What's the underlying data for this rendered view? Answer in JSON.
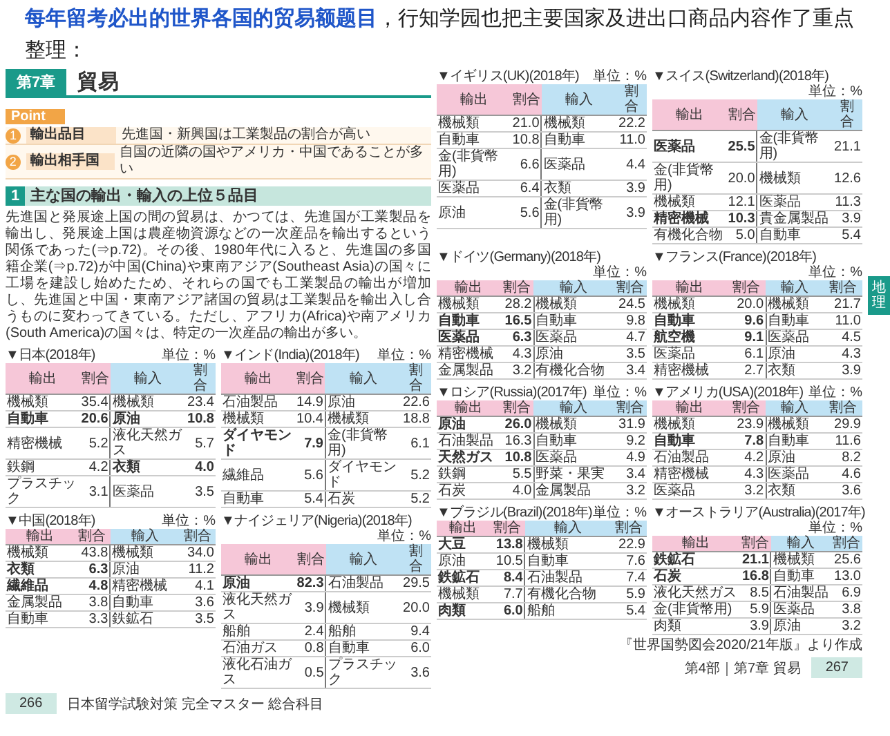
{
  "intro": "**每年留考必出的世界各国的贸易额题目**，行知学园也把主要国家及进出口商品内容作了重点整理：",
  "left_page": {
    "chapter": {
      "label": "第7章",
      "title": "貿易"
    },
    "point": {
      "label": "Point",
      "items": [
        {
          "number": "1",
          "label": "輸出品目",
          "text": "先進国・新興国は工業製品の割合が高い"
        },
        {
          "number": "2",
          "label": "輸出相手国",
          "text": "自国の近隣の国やアメリカ・中国であることが多い"
        }
      ]
    },
    "section": {
      "number": "1",
      "title": "主な国の輸出・輸入の上位５品目"
    },
    "paragraph": "先進国と発展途上国の間の貿易は、かつては、先進国が工業製品を輸出し、発展途上国は農産物資源などの一次産品を輸出するという関係であった(⇒p.72)。その後、1980年代に入ると、先進国の多国籍企業(⇒p.72)が中国(China)や東南アジア(Southeast Asia)の国々に工場を建設し始めたため、それらの国でも工業製品の輸出が増加し、先進国と中国・東南アジア諸国の貿易は工業製品を輸出入し合うものに変わってきている。ただし、アフリカ(Africa)や南アメリカ(South America)の国々は、特定の一次産品の輸出が多い。",
    "tables": [
      {
        "title": "▼日本(2018年)",
        "unit": "単位：%",
        "header": [
          "輸出",
          "割合",
          "輸入",
          "割合"
        ],
        "rows": [
          {
            "export": "機械類",
            "export_share": "35.4",
            "export_bold": false,
            "import": "機械類",
            "import_share": "23.4",
            "import_bold": false
          },
          {
            "export": "自動車",
            "export_share": "20.6",
            "export_bold": true,
            "import": "原油",
            "import_share": "10.8",
            "import_bold": true
          },
          {
            "export": "精密機械",
            "export_share": "5.2",
            "export_bold": false,
            "import": "液化天然ガス",
            "import_share": "5.7",
            "import_bold": false
          },
          {
            "export": "鉄鋼",
            "export_share": "4.2",
            "export_bold": false,
            "import": "衣類",
            "import_share": "4.0",
            "import_bold": true
          },
          {
            "export": "プラスチック",
            "export_share": "3.1",
            "export_bold": false,
            "import": "医薬品",
            "import_share": "3.5",
            "import_bold": false
          }
        ]
      },
      {
        "title": "▼インド(India)(2018年)",
        "unit": "単位：%",
        "header": [
          "輸出",
          "割合",
          "輸入",
          "割合"
        ],
        "rows": [
          {
            "export": "石油製品",
            "export_share": "14.9",
            "export_bold": false,
            "import": "原油",
            "import_share": "22.6",
            "import_bold": false
          },
          {
            "export": "機械類",
            "export_share": "10.4",
            "export_bold": false,
            "import": "機械類",
            "import_share": "18.8",
            "import_bold": false
          },
          {
            "export": "ダイヤモンド",
            "export_share": "7.9",
            "export_bold": true,
            "import": "金(非貨幣用)",
            "import_share": "6.1",
            "import_bold": false
          },
          {
            "export": "繊維品",
            "export_share": "5.6",
            "export_bold": false,
            "import": "ダイヤモンド",
            "import_share": "5.2",
            "import_bold": false
          },
          {
            "export": "自動車",
            "export_share": "5.4",
            "export_bold": false,
            "import": "石炭",
            "import_share": "5.2",
            "import_bold": false
          }
        ]
      },
      {
        "title": "▼中国(2018年)",
        "unit": "単位：%",
        "header": [
          "輸出",
          "割合",
          "輸入",
          "割合"
        ],
        "rows": [
          {
            "export": "機械類",
            "export_share": "43.8",
            "export_bold": false,
            "import": "機械類",
            "import_share": "34.0",
            "import_bold": false
          },
          {
            "export": "衣類",
            "export_share": "6.3",
            "export_bold": true,
            "import": "原油",
            "import_share": "11.2",
            "import_bold": false
          },
          {
            "export": "繊維品",
            "export_share": "4.8",
            "export_bold": true,
            "import": "精密機械",
            "import_share": "4.1",
            "import_bold": false
          },
          {
            "export": "金属製品",
            "export_share": "3.8",
            "export_bold": false,
            "import": "自動車",
            "import_share": "3.6",
            "import_bold": false
          },
          {
            "export": "自動車",
            "export_share": "3.3",
            "export_bold": false,
            "import": "鉄鉱石",
            "import_share": "3.5",
            "import_bold": false
          }
        ]
      },
      {
        "title": "▼ナイジェリア(Nigeria)(2018年)",
        "unit": "単位：%",
        "header": [
          "輸出",
          "割合",
          "輸入",
          "割合"
        ],
        "rows": [
          {
            "export": "原油",
            "export_share": "82.3",
            "export_bold": true,
            "import": "石油製品",
            "import_share": "29.5",
            "import_bold": false
          },
          {
            "export": "液化天然ガス",
            "export_share": "3.9",
            "export_bold": false,
            "import": "機械類",
            "import_share": "20.0",
            "import_bold": false
          },
          {
            "export": "船舶",
            "export_share": "2.4",
            "export_bold": false,
            "import": "船舶",
            "import_share": "9.4",
            "import_bold": false
          },
          {
            "export": "石油ガス",
            "export_share": "0.8",
            "export_bold": false,
            "import": "自動車",
            "import_share": "6.0",
            "import_bold": false
          },
          {
            "export": "液化石油ガス",
            "export_share": "0.5",
            "export_bold": false,
            "import": "プラスチック",
            "import_share": "3.6",
            "import_bold": false
          }
        ]
      }
    ],
    "footer": {
      "page_number": "266",
      "text": "日本留学試験対策 完全マスター 総合科目"
    }
  },
  "right_page": {
    "tables": [
      {
        "title": "▼イギリス(UK)(2018年)",
        "unit": "単位：%",
        "header": [
          "輸出",
          "割合",
          "輸入",
          "割合"
        ],
        "rows": [
          {
            "export": "機械類",
            "export_share": "21.0",
            "export_bold": false,
            "import": "機械類",
            "import_share": "22.2",
            "import_bold": false
          },
          {
            "export": "自動車",
            "export_share": "10.8",
            "export_bold": false,
            "import": "自動車",
            "import_share": "11.0",
            "import_bold": false
          },
          {
            "export": "金(非貨幣用)",
            "export_share": "6.6",
            "export_bold": false,
            "import": "医薬品",
            "import_share": "4.4",
            "import_bold": false
          },
          {
            "export": "医薬品",
            "export_share": "6.4",
            "export_bold": false,
            "import": "衣類",
            "import_share": "3.9",
            "import_bold": false
          },
          {
            "export": "原油",
            "export_share": "5.6",
            "export_bold": false,
            "import": "金(非貨幣用)",
            "import_share": "3.9",
            "import_bold": false
          }
        ]
      },
      {
        "title": "▼スイス(Switzerland)(2018年)",
        "unit": "単位：%",
        "header": [
          "輸出",
          "割合",
          "輸入",
          "割合"
        ],
        "rows": [
          {
            "export": "医薬品",
            "export_share": "25.5",
            "export_bold": true,
            "import": "金(非貨幣用)",
            "import_share": "21.1",
            "import_bold": false
          },
          {
            "export": "金(非貨幣用)",
            "export_share": "20.0",
            "export_bold": false,
            "import": "機械類",
            "import_share": "12.6",
            "import_bold": false
          },
          {
            "export": "機械類",
            "export_share": "12.1",
            "export_bold": false,
            "import": "医薬品",
            "import_share": "11.3",
            "import_bold": false
          },
          {
            "export": "精密機械",
            "export_share": "10.3",
            "export_bold": true,
            "import": "貴金属製品",
            "import_share": "3.9",
            "import_bold": false
          },
          {
            "export": "有機化合物",
            "export_share": "5.0",
            "export_bold": false,
            "import": "自動車",
            "import_share": "5.4",
            "import_bold": false
          }
        ]
      },
      {
        "title": "▼ドイツ(Germany)(2018年)",
        "unit": "単位：%",
        "header": [
          "輸出",
          "割合",
          "輸入",
          "割合"
        ],
        "rows": [
          {
            "export": "機械類",
            "export_share": "28.2",
            "export_bold": false,
            "import": "機械類",
            "import_share": "24.5",
            "import_bold": false
          },
          {
            "export": "自動車",
            "export_share": "16.5",
            "export_bold": true,
            "import": "自動車",
            "import_share": "9.8",
            "import_bold": false
          },
          {
            "export": "医薬品",
            "export_share": "6.3",
            "export_bold": true,
            "import": "医薬品",
            "import_share": "4.7",
            "import_bold": false
          },
          {
            "export": "精密機械",
            "export_share": "4.3",
            "export_bold": false,
            "import": "原油",
            "import_share": "3.5",
            "import_bold": false
          },
          {
            "export": "金属製品",
            "export_share": "3.2",
            "export_bold": false,
            "import": "有機化合物",
            "import_share": "3.4",
            "import_bold": false
          }
        ]
      },
      {
        "title": "▼フランス(France)(2018年)",
        "unit": "単位：%",
        "header": [
          "輸出",
          "割合",
          "輸入",
          "割合"
        ],
        "rows": [
          {
            "export": "機械類",
            "export_share": "20.0",
            "export_bold": false,
            "import": "機械類",
            "import_share": "21.7",
            "import_bold": false
          },
          {
            "export": "自動車",
            "export_share": "9.6",
            "export_bold": true,
            "import": "自動車",
            "import_share": "11.0",
            "import_bold": false
          },
          {
            "export": "航空機",
            "export_share": "9.1",
            "export_bold": true,
            "import": "医薬品",
            "import_share": "4.5",
            "import_bold": false
          },
          {
            "export": "医薬品",
            "export_share": "6.1",
            "export_bold": false,
            "import": "原油",
            "import_share": "4.3",
            "import_bold": false
          },
          {
            "export": "精密機械",
            "export_share": "2.7",
            "export_bold": false,
            "import": "衣類",
            "import_share": "3.9",
            "import_bold": false
          }
        ]
      },
      {
        "title": "▼ロシア(Russia)(2017年)",
        "unit": "単位：%",
        "header": [
          "輸出",
          "割合",
          "輸入",
          "割合"
        ],
        "rows": [
          {
            "export": "原油",
            "export_share": "26.0",
            "export_bold": true,
            "import": "機械類",
            "import_share": "31.9",
            "import_bold": false
          },
          {
            "export": "石油製品",
            "export_share": "16.3",
            "export_bold": false,
            "import": "自動車",
            "import_share": "9.2",
            "import_bold": false
          },
          {
            "export": "天然ガス",
            "export_share": "10.8",
            "export_bold": true,
            "import": "医薬品",
            "import_share": "4.9",
            "import_bold": false
          },
          {
            "export": "鉄鋼",
            "export_share": "5.5",
            "export_bold": false,
            "import": "野菜・果実",
            "import_share": "3.4",
            "import_bold": false
          },
          {
            "export": "石炭",
            "export_share": "4.0",
            "export_bold": false,
            "import": "金属製品",
            "import_share": "3.2",
            "import_bold": false
          }
        ]
      },
      {
        "title": "▼アメリカ(USA)(2018年)",
        "unit": "単位：%",
        "header": [
          "輸出",
          "割合",
          "輸入",
          "割合"
        ],
        "rows": [
          {
            "export": "機械類",
            "export_share": "23.9",
            "export_bold": false,
            "import": "機械類",
            "import_share": "29.9",
            "import_bold": false
          },
          {
            "export": "自動車",
            "export_share": "7.8",
            "export_bold": true,
            "import": "自動車",
            "import_share": "11.6",
            "import_bold": false
          },
          {
            "export": "石油製品",
            "export_share": "4.2",
            "export_bold": false,
            "import": "原油",
            "import_share": "8.2",
            "import_bold": false
          },
          {
            "export": "精密機械",
            "export_share": "4.3",
            "export_bold": false,
            "import": "医薬品",
            "import_share": "4.6",
            "import_bold": false
          },
          {
            "export": "医薬品",
            "export_share": "3.2",
            "export_bold": false,
            "import": "衣類",
            "import_share": "3.6",
            "import_bold": false
          }
        ]
      },
      {
        "title": "▼ブラジル(Brazil)(2018年)",
        "unit": "単位：%",
        "header": [
          "輸出",
          "割合",
          "輸入",
          "割合"
        ],
        "rows": [
          {
            "export": "大豆",
            "export_share": "13.8",
            "export_bold": true,
            "import": "機械類",
            "import_share": "22.9",
            "import_bold": false
          },
          {
            "export": "原油",
            "export_share": "10.5",
            "export_bold": false,
            "import": "自動車",
            "import_share": "7.6",
            "import_bold": false
          },
          {
            "export": "鉄鉱石",
            "export_share": "8.4",
            "export_bold": true,
            "import": "石油製品",
            "import_share": "7.4",
            "import_bold": false
          },
          {
            "export": "機械類",
            "export_share": "7.7",
            "export_bold": false,
            "import": "有機化合物",
            "import_share": "5.9",
            "import_bold": false
          },
          {
            "export": "肉類",
            "export_share": "6.0",
            "export_bold": true,
            "import": "船舶",
            "import_share": "5.4",
            "import_bold": false
          }
        ]
      },
      {
        "title": "▼オーストラリア(Australia)(2017年)",
        "unit": "単位：%",
        "header": [
          "輸出",
          "割合",
          "輸入",
          "割合"
        ],
        "rows": [
          {
            "export": "鉄鉱石",
            "export_share": "21.1",
            "export_bold": true,
            "import": "機械類",
            "import_share": "25.6",
            "import_bold": false
          },
          {
            "export": "石炭",
            "export_share": "16.8",
            "export_bold": true,
            "import": "自動車",
            "import_share": "13.0",
            "import_bold": false
          },
          {
            "export": "液化天然ガス",
            "export_share": "8.5",
            "export_bold": false,
            "import": "石油製品",
            "import_share": "6.9",
            "import_bold": false
          },
          {
            "export": "金(非貨幣用)",
            "export_share": "5.9",
            "export_bold": false,
            "import": "医薬品",
            "import_share": "3.8",
            "import_bold": false
          },
          {
            "export": "肉類",
            "export_share": "3.9",
            "export_bold": false,
            "import": "原油",
            "import_share": "3.2",
            "import_bold": false
          }
        ]
      }
    ],
    "source": "『世界国勢図会2020/21年版』より作成",
    "side_tab": "地理",
    "footer": {
      "text": "第4部｜第7章 貿易",
      "page_number": "267"
    }
  }
}
